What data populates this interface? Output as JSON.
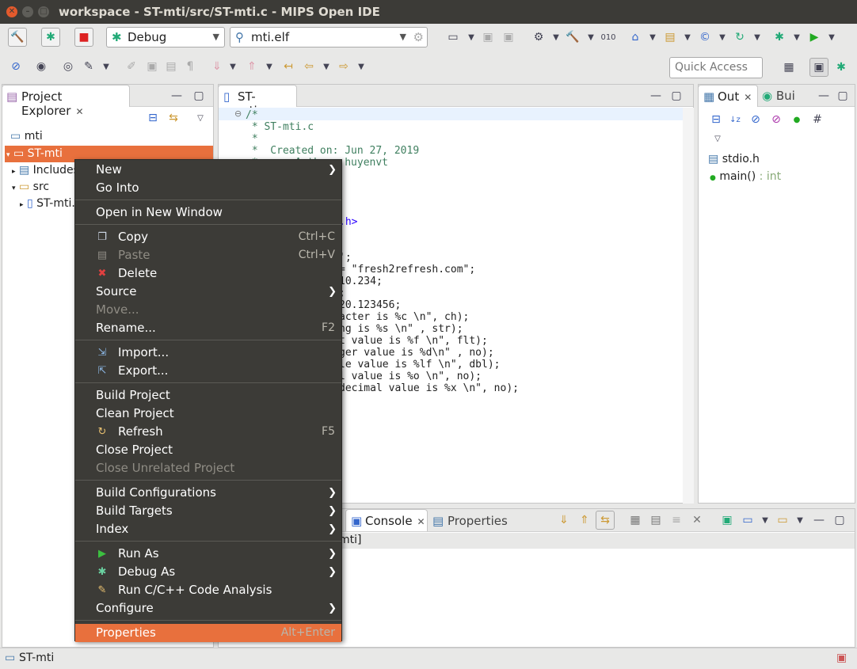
{
  "window": {
    "title": "workspace - ST-mti/src/ST-mti.c - MIPS Open IDE"
  },
  "toolbar": {
    "build_config": "Debug",
    "launch_target": "mti.elf",
    "quick_access_placeholder": "Quick Access"
  },
  "project_explorer": {
    "tab_label": "Project Explorer",
    "items": [
      {
        "label": "mti"
      },
      {
        "label": "ST-mti"
      },
      {
        "label": "Includes"
      },
      {
        "label": "src"
      },
      {
        "label": "ST-mti.c"
      }
    ]
  },
  "editor": {
    "tab_label": "ST-mti.c",
    "lines": [
      "/*",
      " * ST-mti.c",
      " *",
      " *  Created on: Jun 27, 2019",
      " *      Author: huyenvt",
      "",
      "",
      "",
      ".h>",
      "",
      "",
      "';",
      "= \"fresh2refresh.com\";",
      "10.234;",
      ";",
      "20.123456;",
      "acter is %c \\n\", ch);",
      "ng is %s \\n\" , str);",
      "t value is %f \\n\", flt);",
      "ger value is %d\\n\" , no);",
      "le value is %lf \\n\", dbl);",
      "l value is %o \\n\", no);",
      "decimal value is %x \\n\", no);"
    ]
  },
  "outline": {
    "tab_out": "Out",
    "tab_build": "Bui",
    "items": [
      {
        "label": "stdio.h",
        "type": ""
      },
      {
        "label": "main()",
        "type": " : int"
      }
    ]
  },
  "bottom_panel": {
    "tab_console": "Console",
    "tab_properties": "Properties",
    "console_text": "mti]"
  },
  "context_menu": {
    "groups": [
      [
        {
          "label": "New",
          "sub": true
        },
        {
          "label": "Go Into"
        }
      ],
      [
        {
          "label": "Open in New Window"
        }
      ],
      [
        {
          "label": "Copy",
          "shortcut": "Ctrl+C",
          "icon": "copy-icon"
        },
        {
          "label": "Paste",
          "shortcut": "Ctrl+V",
          "icon": "paste-icon",
          "disabled": true
        },
        {
          "label": "Delete",
          "icon": "delete-icon"
        },
        {
          "label": "Source",
          "sub": true
        },
        {
          "label": "Move...",
          "disabled": true
        },
        {
          "label": "Rename...",
          "shortcut": "F2"
        }
      ],
      [
        {
          "label": "Import...",
          "icon": "import-icon"
        },
        {
          "label": "Export...",
          "icon": "export-icon"
        }
      ],
      [
        {
          "label": "Build Project"
        },
        {
          "label": "Clean Project"
        },
        {
          "label": "Refresh",
          "shortcut": "F5",
          "icon": "refresh-icon"
        },
        {
          "label": "Close Project"
        },
        {
          "label": "Close Unrelated Project",
          "disabled": true
        }
      ],
      [
        {
          "label": "Build Configurations",
          "sub": true
        },
        {
          "label": "Build Targets",
          "sub": true
        },
        {
          "label": "Index",
          "sub": true
        }
      ],
      [
        {
          "label": "Run As",
          "sub": true,
          "icon": "run-icon"
        },
        {
          "label": "Debug As",
          "sub": true,
          "icon": "debug-icon"
        },
        {
          "label": "Run C/C++ Code Analysis",
          "icon": "code-analysis-icon"
        },
        {
          "label": "Configure",
          "sub": true
        }
      ],
      [
        {
          "label": "Properties",
          "shortcut": "Alt+Enter",
          "highlighted": true
        }
      ]
    ]
  },
  "status": {
    "selection": "ST-mti"
  }
}
